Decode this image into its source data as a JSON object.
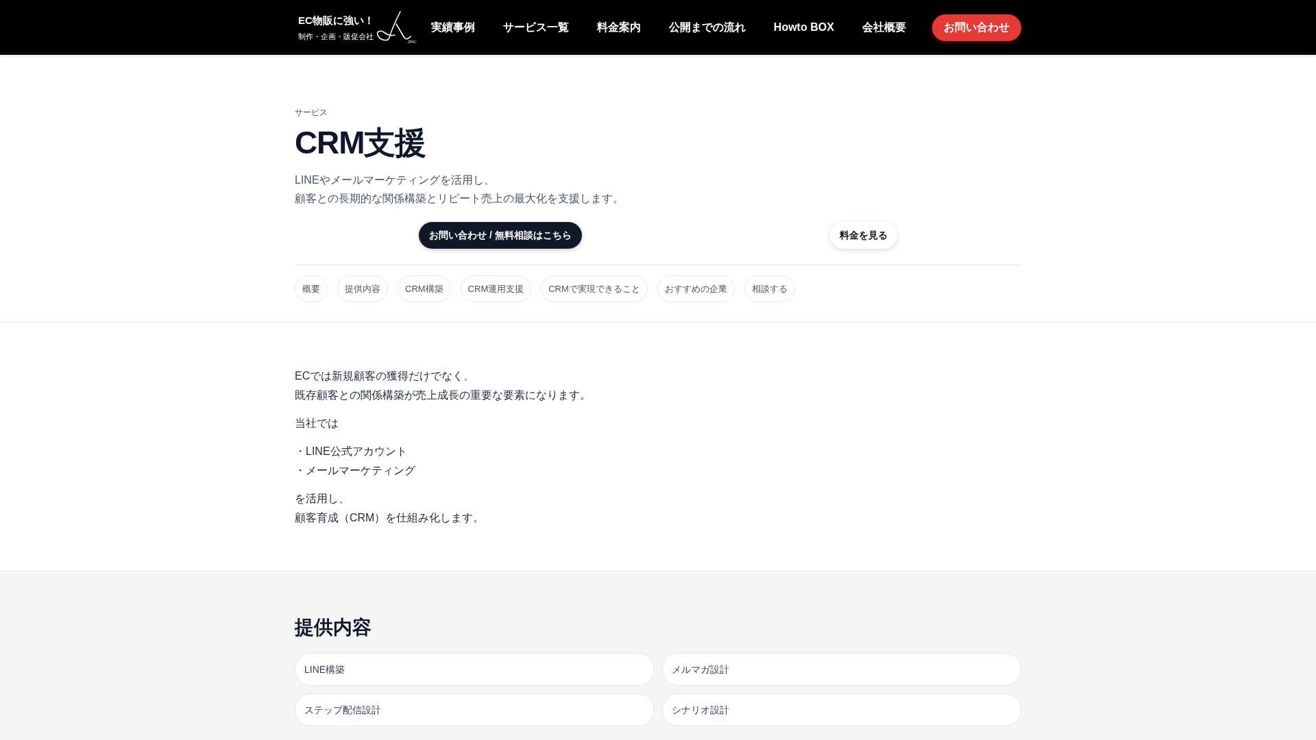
{
  "header": {
    "logo": {
      "tagline": "EC物販に強い！",
      "subtitle": "制作・企画・販促会社",
      "suffix": ".INC"
    },
    "nav": [
      "実績事例",
      "サービス一覧",
      "料金案内",
      "公開までの流れ",
      "Howto BOX",
      "会社概要"
    ],
    "cta": "お問い合わせ"
  },
  "hero": {
    "breadcrumb": "サービス",
    "title": "CRM支援",
    "description": [
      "LINEやメールマーケティングを活用し、",
      "顧客との長期的な関係構築とリピート売上の最大化を支援します。"
    ],
    "buttons": [
      {
        "label": "お問い合わせ / 無料相談はこちら",
        "kind": "primary"
      },
      {
        "label": "料金を見る",
        "kind": "secondary"
      }
    ],
    "section_links": [
      "概要",
      "提供内容",
      "CRM構築",
      "CRM運用支援",
      "CRMで実現できること",
      "おすすめの企業",
      "相談する"
    ]
  },
  "intro": {
    "paragraphs": [
      [
        "ECでは新規顧客の獲得だけでなく、",
        "既存顧客との関係構築が売上成長の重要な要素になります。"
      ],
      [
        "当社では"
      ],
      [
        "・LINE公式アカウント",
        "・メールマーケティング"
      ],
      [
        "を活用し、",
        "顧客育成（CRM）を仕組み化します。"
      ]
    ]
  },
  "offerings": {
    "title": "提供内容",
    "items": [
      "LINE構築",
      "メルマガ設計",
      "ステップ配信設計",
      "シナリオ設計"
    ]
  }
}
